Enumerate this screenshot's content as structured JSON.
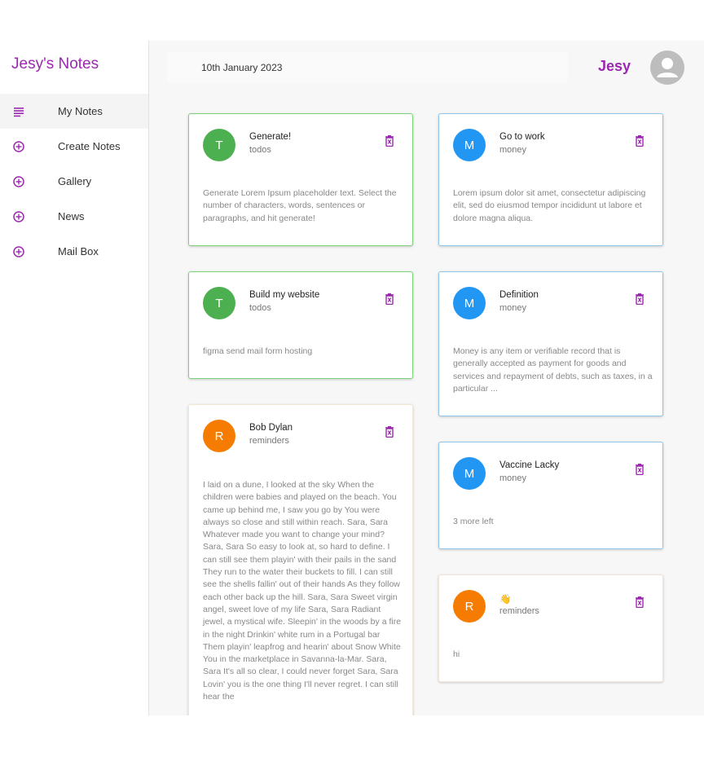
{
  "app": {
    "brand": "Jesy's Notes"
  },
  "sidebar": {
    "items": [
      {
        "label": "My Notes",
        "icon": "list-icon",
        "active": true
      },
      {
        "label": "Create Notes",
        "icon": "add-circle-icon"
      },
      {
        "label": "Gallery",
        "icon": "add-circle-icon"
      },
      {
        "label": "News",
        "icon": "add-circle-icon"
      },
      {
        "label": "Mail Box",
        "icon": "add-circle-icon"
      }
    ]
  },
  "header": {
    "date": "10th January 2023",
    "user": "Jesy",
    "avatar_icon": "person-icon"
  },
  "colors": {
    "accent": "#9c27b0",
    "todos": "#4caf50",
    "money": "#2196f3",
    "reminders": "#f57c00"
  },
  "notes": [
    {
      "initial": "T",
      "title": "Generate!",
      "category": "todos",
      "body": "Generate Lorem Ipsum placeholder text. Select the number of characters, words, sentences or paragraphs, and hit generate!"
    },
    {
      "initial": "M",
      "title": "Go to work",
      "category": "money",
      "body": "Lorem ipsum dolor sit amet, consectetur adipiscing elit, sed do eiusmod tempor incididunt ut labore et dolore magna aliqua."
    },
    {
      "initial": "T",
      "title": "Build my website",
      "category": "todos",
      "body": "figma send mail form hosting"
    },
    {
      "initial": "M",
      "title": "Definition",
      "category": "money",
      "body": "Money is any item or verifiable record that is generally accepted as payment for goods and services and repayment of debts, such as taxes, in a particular ..."
    },
    {
      "initial": "R",
      "title": "Bob Dylan",
      "category": "reminders",
      "body": "I laid on a dune, I looked at the sky When the children were babies and played on the beach. You came up behind me, I saw you go by You were always so close and still within reach. Sara, Sara Whatever made you want to change your mind? Sara, Sara So easy to look at, so hard to define. I can still see them playin' with their pails in the sand They run to the water their buckets to fill. I can still see the shells fallin' out of their hands As they follow each other back up the hill. Sara, Sara Sweet virgin angel, sweet love of my life Sara, Sara Radiant jewel, a mystical wife. Sleepin' in the woods by a fire in the night Drinkin' white rum in a Portugal bar Them playin' leapfrog and hearin' about Snow White You in the marketplace in Savanna-la-Mar. Sara, Sara It's all so clear, I could never forget Sara, Sara Lovin' you is the one thing I'll never regret. I can still hear the"
    },
    {
      "initial": "M",
      "title": "Vaccine Lacky",
      "category": "money",
      "body": "3 more left"
    },
    {
      "initial": "R",
      "title": "👋",
      "category": "reminders",
      "body": "hi"
    }
  ]
}
